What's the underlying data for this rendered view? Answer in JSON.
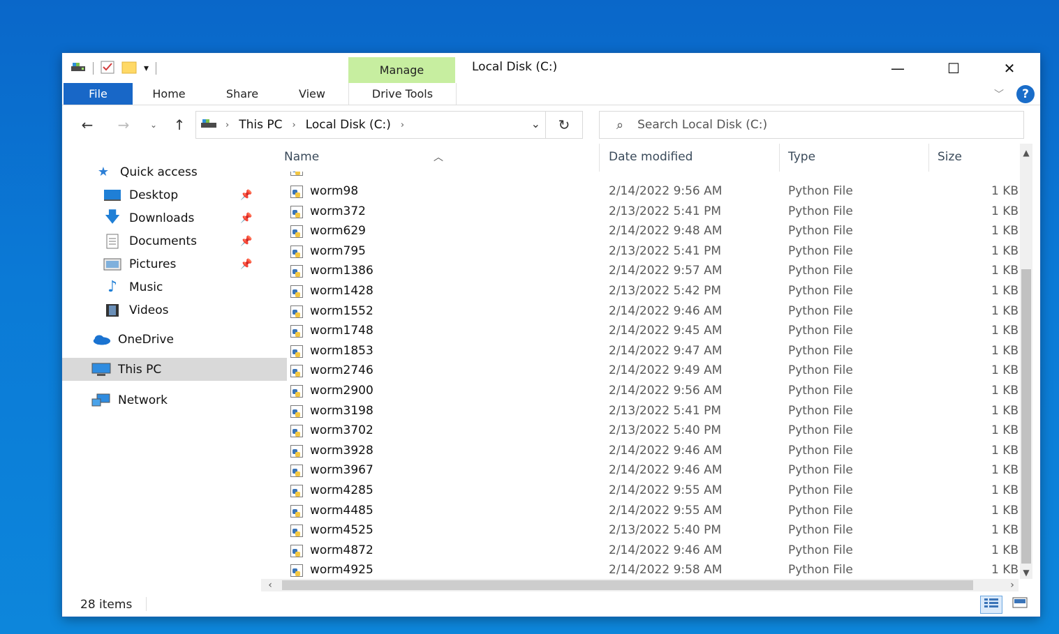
{
  "window": {
    "title": "Local Disk (C:)",
    "manage_label": "Manage",
    "controls": {
      "minimize": "—",
      "maximize": "☐",
      "close": "✕"
    }
  },
  "ribbon": {
    "tabs": [
      "File",
      "Home",
      "Share",
      "View",
      "Drive Tools"
    ],
    "help": "?"
  },
  "address": {
    "crumbs": [
      "This PC",
      "Local Disk (C:)"
    ],
    "search_placeholder": "Search Local Disk (C:)"
  },
  "sidebar": {
    "quick_access": "Quick access",
    "items": [
      {
        "label": "Desktop",
        "icon": "desktop-icon",
        "pinned": true
      },
      {
        "label": "Downloads",
        "icon": "downloads-icon",
        "pinned": true
      },
      {
        "label": "Documents",
        "icon": "documents-icon",
        "pinned": true
      },
      {
        "label": "Pictures",
        "icon": "pictures-icon",
        "pinned": true
      },
      {
        "label": "Music",
        "icon": "music-icon",
        "pinned": false
      },
      {
        "label": "Videos",
        "icon": "videos-icon",
        "pinned": false
      }
    ],
    "onedrive": "OneDrive",
    "this_pc": "This PC",
    "network": "Network"
  },
  "columns": {
    "name": "Name",
    "date": "Date modified",
    "type": "Type",
    "size": "Size"
  },
  "files": [
    {
      "name": "worm98",
      "date": "2/14/2022 9:56 AM",
      "type": "Python File",
      "size": "1 KB"
    },
    {
      "name": "worm372",
      "date": "2/13/2022 5:41 PM",
      "type": "Python File",
      "size": "1 KB"
    },
    {
      "name": "worm629",
      "date": "2/14/2022 9:48 AM",
      "type": "Python File",
      "size": "1 KB"
    },
    {
      "name": "worm795",
      "date": "2/13/2022 5:41 PM",
      "type": "Python File",
      "size": "1 KB"
    },
    {
      "name": "worm1386",
      "date": "2/14/2022 9:57 AM",
      "type": "Python File",
      "size": "1 KB"
    },
    {
      "name": "worm1428",
      "date": "2/13/2022 5:42 PM",
      "type": "Python File",
      "size": "1 KB"
    },
    {
      "name": "worm1552",
      "date": "2/14/2022 9:46 AM",
      "type": "Python File",
      "size": "1 KB"
    },
    {
      "name": "worm1748",
      "date": "2/14/2022 9:45 AM",
      "type": "Python File",
      "size": "1 KB"
    },
    {
      "name": "worm1853",
      "date": "2/14/2022 9:47 AM",
      "type": "Python File",
      "size": "1 KB"
    },
    {
      "name": "worm2746",
      "date": "2/14/2022 9:49 AM",
      "type": "Python File",
      "size": "1 KB"
    },
    {
      "name": "worm2900",
      "date": "2/14/2022 9:56 AM",
      "type": "Python File",
      "size": "1 KB"
    },
    {
      "name": "worm3198",
      "date": "2/13/2022 5:41 PM",
      "type": "Python File",
      "size": "1 KB"
    },
    {
      "name": "worm3702",
      "date": "2/13/2022 5:40 PM",
      "type": "Python File",
      "size": "1 KB"
    },
    {
      "name": "worm3928",
      "date": "2/14/2022 9:46 AM",
      "type": "Python File",
      "size": "1 KB"
    },
    {
      "name": "worm3967",
      "date": "2/14/2022 9:46 AM",
      "type": "Python File",
      "size": "1 KB"
    },
    {
      "name": "worm4285",
      "date": "2/14/2022 9:55 AM",
      "type": "Python File",
      "size": "1 KB"
    },
    {
      "name": "worm4485",
      "date": "2/14/2022 9:55 AM",
      "type": "Python File",
      "size": "1 KB"
    },
    {
      "name": "worm4525",
      "date": "2/13/2022 5:40 PM",
      "type": "Python File",
      "size": "1 KB"
    },
    {
      "name": "worm4872",
      "date": "2/14/2022 9:46 AM",
      "type": "Python File",
      "size": "1 KB"
    },
    {
      "name": "worm4925",
      "date": "2/14/2022 9:58 AM",
      "type": "Python File",
      "size": "1 KB"
    }
  ],
  "status": {
    "count": "28 items"
  },
  "colors": {
    "file_tab": "#1867c7",
    "manage_tab": "#c7eea0",
    "selected_nav": "#d9d9d9"
  }
}
